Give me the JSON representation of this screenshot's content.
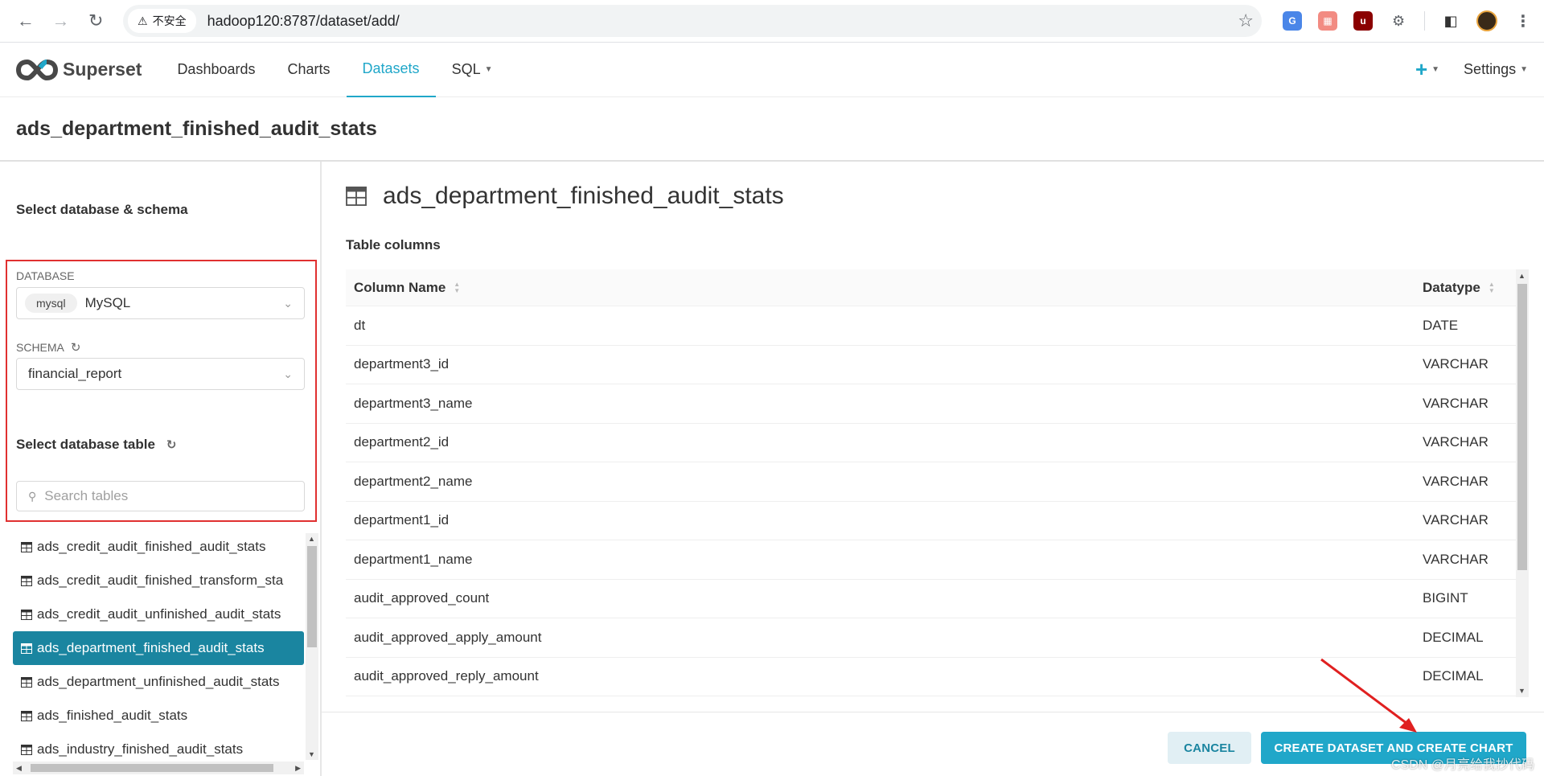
{
  "browser": {
    "security_label": "不安全",
    "url": "hadoop120:8787/dataset/add/"
  },
  "header": {
    "brand": "Superset",
    "nav": [
      {
        "label": "Dashboards"
      },
      {
        "label": "Charts"
      },
      {
        "label": "Datasets",
        "active": true
      },
      {
        "label": "SQL"
      }
    ],
    "settings_label": "Settings",
    "plus_label": "+"
  },
  "page_title": "ads_department_finished_audit_stats",
  "left": {
    "heading": "Select database & schema",
    "database_label": "DATABASE",
    "database_tag": "mysql",
    "database_value": "MySQL",
    "schema_label": "SCHEMA",
    "schema_value": "financial_report",
    "table_heading": "Select database table",
    "search_placeholder": "Search tables",
    "tables": [
      "ads_credit_audit_finished_audit_stats",
      "ads_credit_audit_finished_transform_sta",
      "ads_credit_audit_unfinished_audit_stats",
      "ads_department_finished_audit_stats",
      "ads_department_unfinished_audit_stats",
      "ads_finished_audit_stats",
      "ads_industry_finished_audit_stats"
    ],
    "selected_index": 3
  },
  "right": {
    "dataset_title": "ads_department_finished_audit_stats",
    "columns_label": "Table columns",
    "col_header_name": "Column Name",
    "col_header_type": "Datatype",
    "rows": [
      {
        "name": "dt",
        "type": "DATE"
      },
      {
        "name": "department3_id",
        "type": "VARCHAR"
      },
      {
        "name": "department3_name",
        "type": "VARCHAR"
      },
      {
        "name": "department2_id",
        "type": "VARCHAR"
      },
      {
        "name": "department2_name",
        "type": "VARCHAR"
      },
      {
        "name": "department1_id",
        "type": "VARCHAR"
      },
      {
        "name": "department1_name",
        "type": "VARCHAR"
      },
      {
        "name": "audit_approved_count",
        "type": "BIGINT"
      },
      {
        "name": "audit_approved_apply_amount",
        "type": "DECIMAL"
      },
      {
        "name": "audit_approved_reply_amount",
        "type": "DECIMAL"
      }
    ]
  },
  "footer": {
    "cancel_label": "CANCEL",
    "create_label": "CREATE DATASET AND CREATE CHART"
  },
  "watermark": "CSDN @月亮给我抄代码",
  "colors": {
    "accent": "#20a7c9",
    "selected": "#1a85a0",
    "highlight_box": "#e03030"
  }
}
